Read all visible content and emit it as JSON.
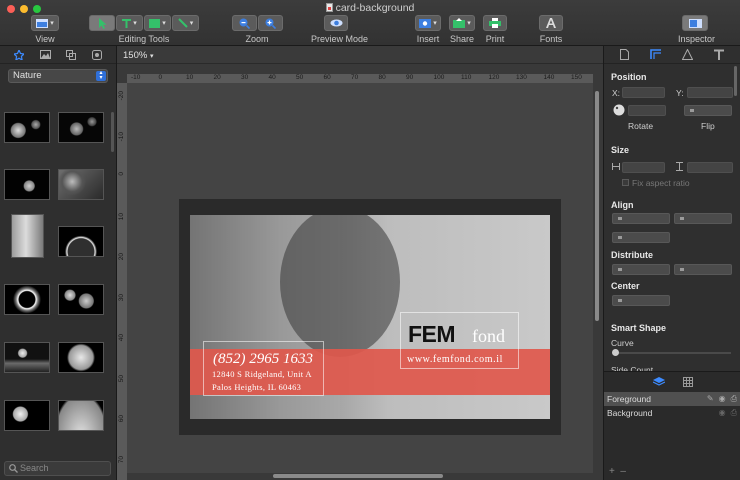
{
  "window": {
    "title": "card-background"
  },
  "toolbar": {
    "view_label": "View",
    "editing_tools_label": "Editing Tools",
    "zoom_label": "Zoom",
    "preview_label": "Preview Mode",
    "insert_label": "Insert",
    "share_label": "Share",
    "print_label": "Print",
    "fonts_label": "Fonts",
    "inspector_label": "Inspector"
  },
  "left_panel": {
    "category": "Nature",
    "search_placeholder": "Search"
  },
  "canvas": {
    "zoom": "150%",
    "ruler_h": [
      "-10",
      "0",
      "10",
      "20",
      "30",
      "40",
      "50",
      "60",
      "70",
      "80",
      "90",
      "100",
      "110",
      "120",
      "130",
      "140",
      "150"
    ],
    "ruler_v": [
      "-20",
      "-10",
      "0",
      "10",
      "20",
      "30",
      "40",
      "50",
      "60",
      "70"
    ]
  },
  "card": {
    "phone": "(852) 2965 1633",
    "address_line1": "12840 S Ridgeland, Unit A",
    "address_line2": "Palos Heights, IL 60463",
    "brand_bold": "FEM",
    "brand_light": "fond",
    "website": "www.femfond.com.il"
  },
  "inspector": {
    "position_title": "Position",
    "x_label": "X:",
    "y_label": "Y:",
    "rotate_label": "Rotate",
    "flip_label": "Flip",
    "size_title": "Size",
    "fix_aspect_label": "Fix aspect ratio",
    "align_title": "Align",
    "distribute_title": "Distribute",
    "center_title": "Center",
    "smart_shape_title": "Smart Shape",
    "curve_label": "Curve",
    "side_count_label": "Side Count"
  },
  "layers": {
    "items": [
      {
        "name": "Foreground",
        "selected": true
      },
      {
        "name": "Background",
        "selected": false
      }
    ]
  },
  "colors": {
    "accent_blue": "#2f6fd8",
    "brand_red": "#e0584c",
    "toolbar_green": "#34c06a"
  }
}
